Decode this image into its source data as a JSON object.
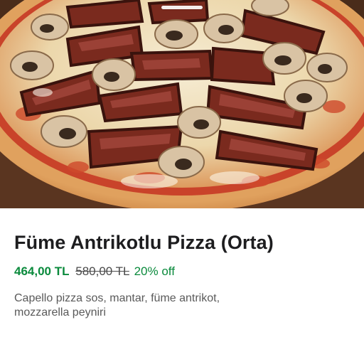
{
  "product": {
    "name": "Füme Antrikotlu Pizza (Orta)",
    "price": "464,00 TL",
    "original_price": "580,00 TL",
    "discount": "20% off",
    "description": "Capello pizza sos, mantar, füme antrikot, mozzarella peyniri"
  },
  "colors": {
    "price_accent": "#0a8a3c",
    "title_text": "#1d1d1f",
    "description_text": "#5a5a5a"
  }
}
